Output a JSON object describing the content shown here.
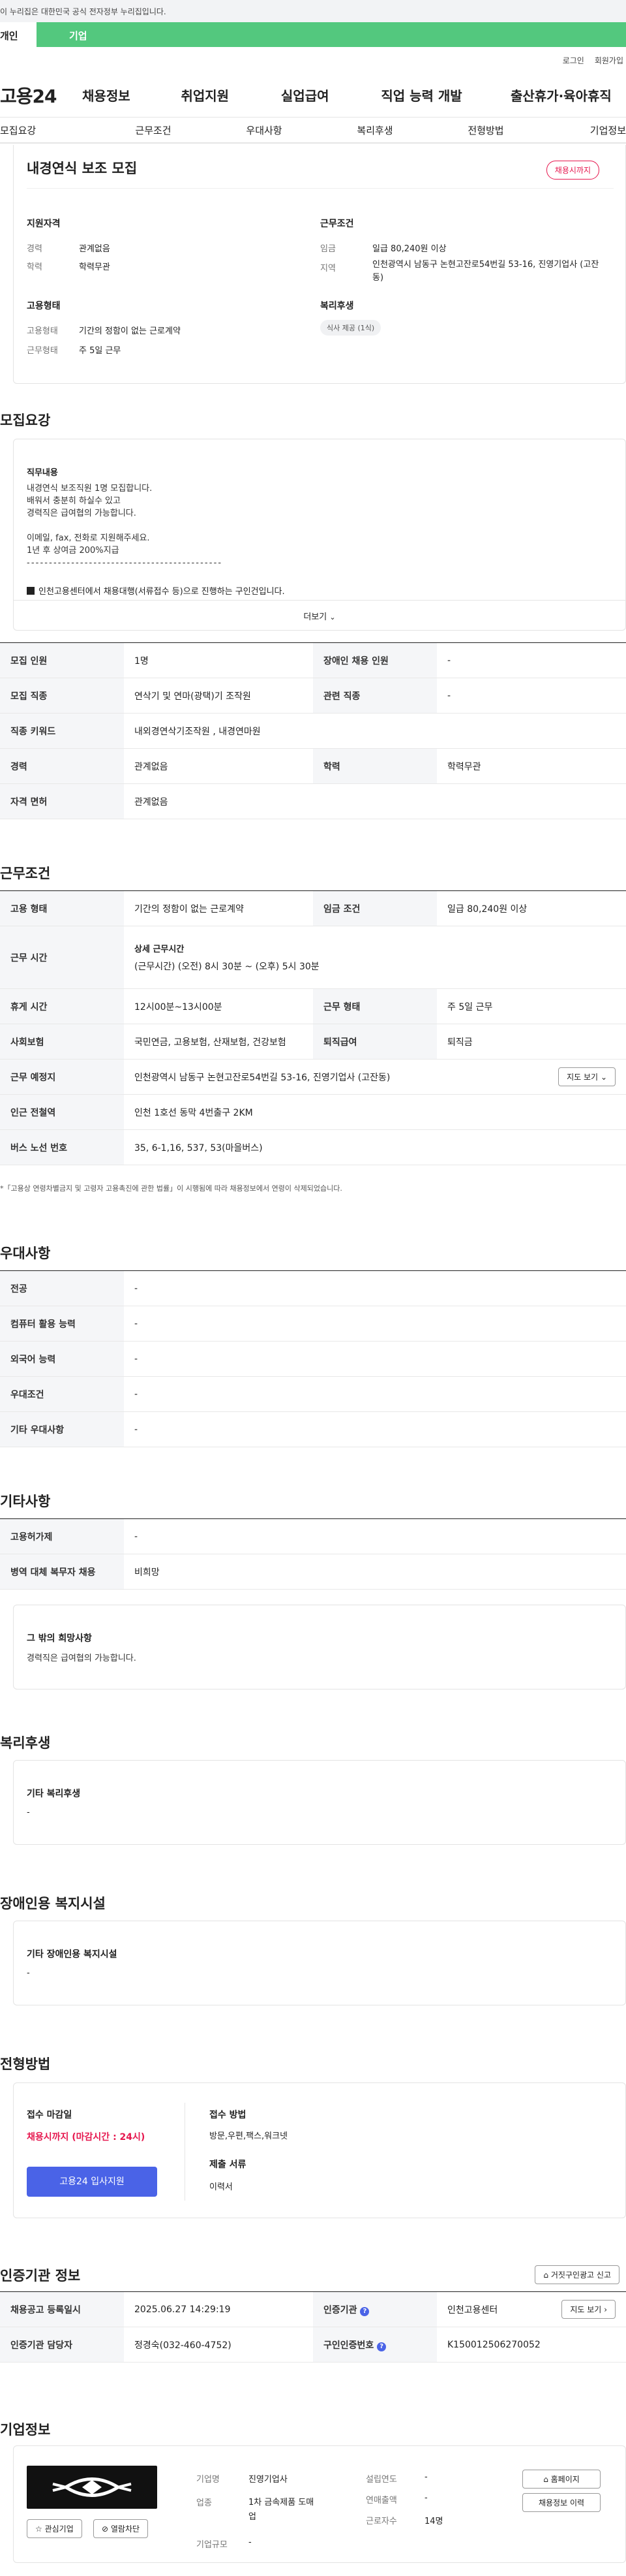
{
  "gov_banner": "이 누리집은 대한민국 공식 전자정부 누리집입니다.",
  "tabs": {
    "personal": "개인",
    "corporate": "기업"
  },
  "util": {
    "login": "로그인",
    "join": "회원가입"
  },
  "logo": "고용24",
  "gnb": [
    "채용정보",
    "취업지원",
    "실업급여",
    "직업 능력 개발",
    "출산휴가·육아휴직"
  ],
  "subnav": [
    "모집요강",
    "근무조건",
    "우대사항",
    "복리후생",
    "전형방법",
    "기업정보"
  ],
  "summary": {
    "title": "내경연식 보조 모집",
    "badge": "채용시까지",
    "qual_h": "지원자격",
    "career_k": "경력",
    "career_v": "관계없음",
    "edu_k": "학력",
    "edu_v": "학력무관",
    "emp_h": "고용형태",
    "emptype_k": "고용형태",
    "emptype_v": "기간의 정함이 없는 근로계약",
    "workdays_k": "근무형태",
    "workdays_v": "주 5일 근무",
    "cond_h": "근무조건",
    "wage_k": "임금",
    "wage_v": "일급 80,240원 이상",
    "region_k": "지역",
    "region_v": "인천광역시 남동구 논현고잔로54번길 53-16, 진영기업사 (고잔동)",
    "welfare_h": "복리후생",
    "welfare_tag": "식사 제공 (1식)"
  },
  "recruit": {
    "heading": "모집요강",
    "duty_h": "직무내용",
    "duty_lines": [
      "내경연식 보조직원 1명 모집합니다.",
      "배워서 충분히 하실수 있고",
      "경력직은 급여협의 가능합니다.",
      "",
      "이메일, fax, 전화로 지원해주세요.",
      "1년 후 상여금 200%지급",
      "- - - - - - - - - - - - - - - - - - - - - - - - - - - - - - - - - - - - - - - - - - - -"
    ],
    "notice": "인천고용센터에서 채용대행(서류접수 등)으로 진행하는 구인건입니다.",
    "more": "더보기",
    "rows": [
      [
        "모집 인원",
        "1명",
        "장애인 채용 인원",
        "-"
      ],
      [
        "모집 직종",
        "연삭기 및 연마(광택)기 조작원",
        "관련 직종",
        "-"
      ],
      [
        "직종 키워드",
        "내외경연삭기조작원 , 내경연마원",
        "",
        ""
      ],
      [
        "경력",
        "관계없음",
        "학력",
        "학력무관"
      ],
      [
        "자격 면허",
        "관계없음",
        "",
        ""
      ]
    ]
  },
  "conditions": {
    "heading": "근무조건",
    "emptype_k": "고용 형태",
    "emptype_v": "기간의 정함이 없는 근로계약",
    "wagecond_k": "임금 조건",
    "wagecond_v": "일급 80,240원 이상",
    "hours_k": "근무 시간",
    "hours_sub": "상세 근무시간",
    "hours_v": "(근무시간) (오전) 8시 30분 ~ (오후) 5시 30분",
    "rest_k": "휴게 시간",
    "rest_v": "12시00분~13시00분",
    "worktype_k": "근무 형태",
    "worktype_v": "주 5일 근무",
    "insurance_k": "사회보험",
    "insurance_v": "국민연금, 고용보험, 산재보험, 건강보험",
    "retire_k": "퇴직급여",
    "retire_v": "퇴직금",
    "place_k": "근무 예정지",
    "place_v": "인천광역시 남동구 논현고잔로54번길 53-16, 진영기업사 (고잔동)",
    "map_btn": "지도 보기",
    "subway_k": "인근 전철역",
    "subway_v": "인천 1호선 동막 4번출구 2KM",
    "bus_k": "버스 노선 번호",
    "bus_v": "35, 6-1,16, 537, 53(마을버스)",
    "footnote": "*「고용상 연령차별금지 및 고령자 고용촉진에 관한 법률」이 시행됨에 따라 채용정보에서 연령이 삭제되었습니다."
  },
  "preference": {
    "heading": "우대사항",
    "rows": [
      [
        "전공",
        "-"
      ],
      [
        "컴퓨터 활용 능력",
        "-"
      ],
      [
        "외국어 능력",
        "-"
      ],
      [
        "우대조건",
        "-"
      ],
      [
        "기타 우대사항",
        "-"
      ]
    ]
  },
  "etc": {
    "heading": "기타사항",
    "rows": [
      [
        "고용허가제",
        "-"
      ],
      [
        "병역 대체 복무자 채용",
        "비희망"
      ]
    ],
    "wish_h": "그 밖의 희망사항",
    "wish_v": "경력직은 급여협의 가능합니다."
  },
  "welfare": {
    "heading": "복리후생",
    "label": "기타 복리후생",
    "value": "-"
  },
  "disabled": {
    "heading": "장애인용 복지시설",
    "label": "기타 장애인용 복지시설",
    "value": "-"
  },
  "selection": {
    "heading": "전형방법",
    "deadline_h": "접수 마감일",
    "deadline_v": "채용시까지 (마감시간 : 24시)",
    "apply_btn": "고용24 입사지원",
    "method_h": "접수 방법",
    "method_v": "방문,우편,팩스,워크넷",
    "docs_h": "제출 서류",
    "docs_v": "이력서"
  },
  "agency": {
    "heading": "인증기관 정보",
    "report_btn": "거짓구인광고 신고",
    "reg_k": "채용공고 등록일시",
    "reg_v": "2025.06.27 14:29:19",
    "org_k": "인증기관",
    "org_v": "인천고용센터",
    "org_btn": "지도 보기",
    "mgr_k": "인증기관 담당자",
    "mgr_v": "정경숙(032-460-4752)",
    "no_k": "구인인증번호",
    "no_v": "K150012506270052"
  },
  "company": {
    "heading": "기업정보",
    "interest_btn": "관심기업",
    "block_btn": "열람차단",
    "name_k": "기업명",
    "name_v": "진영기업사",
    "industry_k": "업종",
    "industry_v": "1차 금속제품 도매업",
    "size_k": "기업규모",
    "size_v": "-",
    "founded_k": "설립연도",
    "founded_v": "-",
    "sales_k": "연매출액",
    "sales_v": "-",
    "staff_k": "근로자수",
    "staff_v": "14명",
    "home_btn": "홈페이지",
    "history_btn": "채용정보 이력"
  },
  "colors": {
    "green": "#53c87e",
    "blue": "#4a63e7",
    "red": "#e6184f"
  }
}
